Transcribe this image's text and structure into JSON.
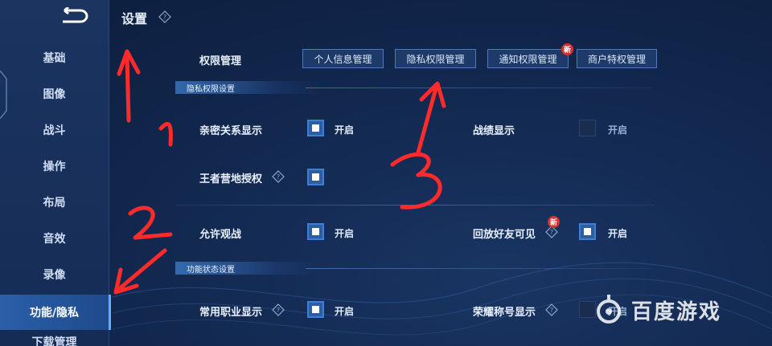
{
  "header": {
    "title": "设置"
  },
  "sidebar": {
    "items": [
      {
        "label": "基础"
      },
      {
        "label": "图像"
      },
      {
        "label": "战斗"
      },
      {
        "label": "操作"
      },
      {
        "label": "布局"
      },
      {
        "label": "音效"
      },
      {
        "label": "录像"
      },
      {
        "label": "功能/隐私",
        "active": true
      },
      {
        "label": "下载管理"
      }
    ]
  },
  "permissions": {
    "label": "权限管理",
    "buttons": [
      {
        "label": "个人信息管理"
      },
      {
        "label": "隐私权限管理"
      },
      {
        "label": "通知权限管理",
        "badge": "新"
      },
      {
        "label": "商户特权管理"
      }
    ]
  },
  "privacy_section": {
    "title": "隐私权限设置",
    "settings": [
      {
        "label": "亲密关系显示",
        "checked": true,
        "state": "开启"
      },
      {
        "label": "战绩显示",
        "checked": false,
        "state": "开启"
      },
      {
        "label": "王者营地授权",
        "checked": true
      },
      {
        "label": "允许观战",
        "checked": true,
        "state": "开启"
      },
      {
        "label": "回放好友可见",
        "checked": true,
        "state": "开启",
        "badge": "新"
      }
    ]
  },
  "function_section": {
    "title": "功能状态设置",
    "settings": [
      {
        "label": "常用职业显示",
        "checked": true,
        "state": "开启"
      },
      {
        "label": "荣耀称号显示",
        "checked": false,
        "state": "开启"
      }
    ]
  },
  "annotations": [
    "1",
    "2",
    "3"
  ],
  "watermark": {
    "text": "百度游戏"
  },
  "colors": {
    "accent": "#3f7ed0",
    "badge": "#d8322c",
    "annotation": "#ff2a2a"
  }
}
